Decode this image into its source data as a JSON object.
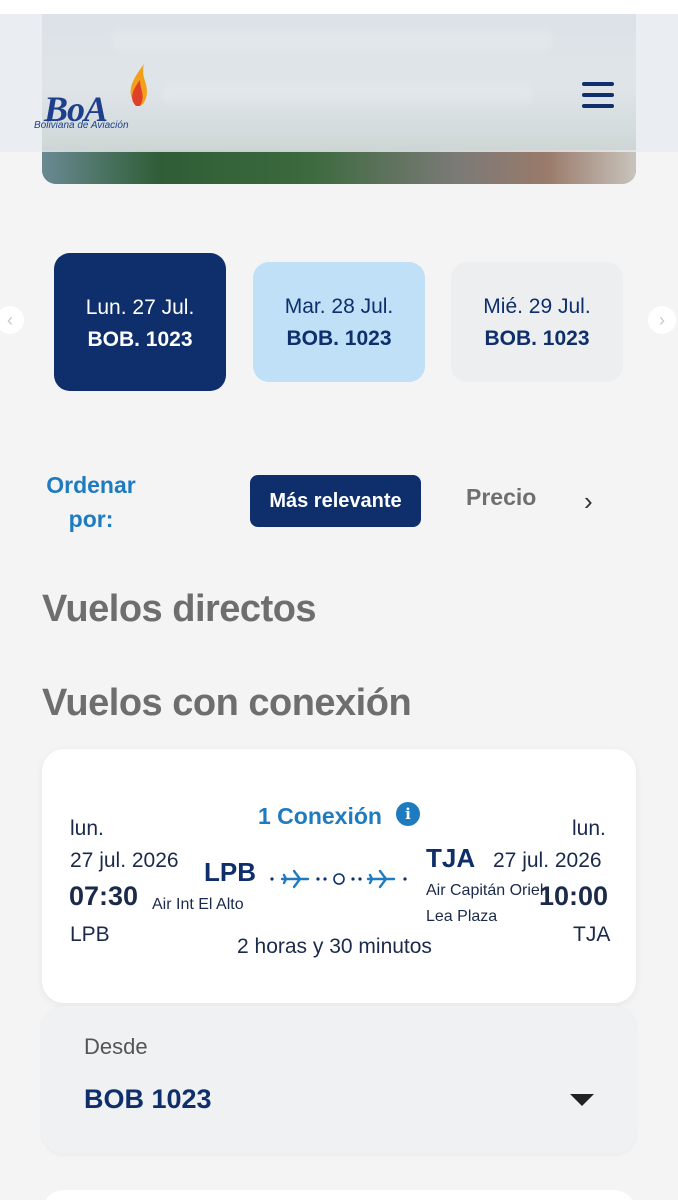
{
  "brand": {
    "name": "BoA",
    "tagline": "Boliviana de Aviación"
  },
  "dates": [
    {
      "day": "Lun. 27 Jul.",
      "price": "BOB. 1023",
      "state": "selected"
    },
    {
      "day": "Mar. 28 Jul.",
      "price": "BOB. 1023",
      "state": "highlight"
    },
    {
      "day": "Mié. 29 Jul.",
      "price": "BOB. 1023",
      "state": "default"
    }
  ],
  "sort": {
    "label": "Ordenar por:",
    "options": [
      "Más relevante",
      "Precio"
    ],
    "next_icon": "chevron-right-icon"
  },
  "sections": {
    "direct": "Vuelos directos",
    "connection": "Vuelos con conexión"
  },
  "flight": {
    "connection_label": "1 Conexión",
    "departure": {
      "weekday": "lun.",
      "date": "27 jul. 2026",
      "time": "07:30",
      "code_small": "LPB",
      "code_big": "LPB",
      "airport": "Air Int El Alto"
    },
    "arrival": {
      "weekday": "lun.",
      "date": "27 jul. 2026",
      "time": "10:00",
      "code_small": "TJA",
      "code_big": "TJA",
      "airport_line1": "Air Capitán Oriel",
      "airport_line2": "Lea Plaza"
    },
    "duration": "2 horas y 30 minutos"
  },
  "fare": {
    "label": "Desde",
    "value": "BOB 1023"
  },
  "colors": {
    "primary": "#0e2f6b",
    "accent": "#1f7bbf",
    "light": "#bfe0f6"
  }
}
